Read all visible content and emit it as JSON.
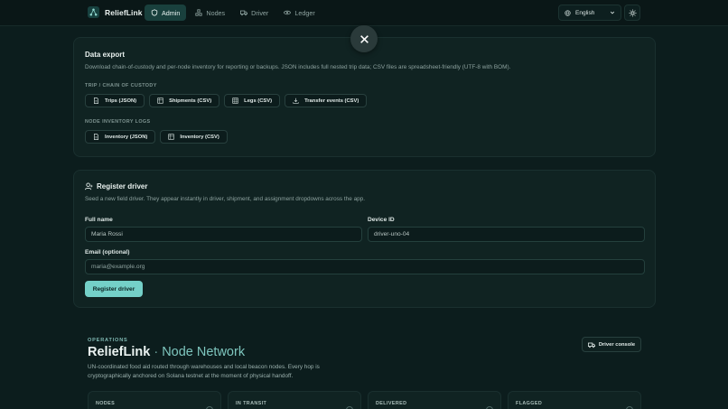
{
  "nav": {
    "brand": "ReliefLink",
    "items": [
      {
        "label": "Admin",
        "active": true
      },
      {
        "label": "Nodes",
        "active": false
      },
      {
        "label": "Driver",
        "active": false
      },
      {
        "label": "Ledger",
        "active": false
      }
    ],
    "language": "English"
  },
  "export": {
    "title": "Data export",
    "description": "Download chain-of-custody and per-node inventory for reporting or backups. JSON includes full nested trip data; CSV files are spreadsheet-friendly (UTF-8 with BOM).",
    "trip_section": "TRIP / CHAIN OF CUSTODY",
    "trip_buttons": [
      "Trips (JSON)",
      "Shipments (CSV)",
      "Legs (CSV)",
      "Transfer events (CSV)"
    ],
    "inventory_section": "NODE INVENTORY LOGS",
    "inventory_buttons": [
      "Inventory (JSON)",
      "Inventory (CSV)"
    ]
  },
  "register": {
    "title": "Register driver",
    "description": "Seed a new field driver. They appear instantly in driver, shipment, and assignment dropdowns across the app.",
    "full_name_label": "Full name",
    "full_name_value": "Maria Rossi",
    "device_id_label": "Device ID",
    "device_id_value": "driver-uno-04",
    "email_label": "Email (optional)",
    "email_placeholder": "maria@example.org",
    "submit_label": "Register driver"
  },
  "hero": {
    "eyebrow": "OPERATIONS",
    "title": "ReliefLink",
    "separator": "·",
    "subtitle": "Node Network",
    "description": "UN-coordinated food aid routed through warehouses and local beacon nodes. Every hop is cryptographically anchored on Solana testnet at the moment of physical handoff.",
    "console_button": "Driver console"
  },
  "stats": [
    {
      "label": "NODES"
    },
    {
      "label": "IN TRANSIT"
    },
    {
      "label": "DELIVERED"
    },
    {
      "label": "FLAGGED"
    }
  ],
  "colors": {
    "background": "#0c1d1d",
    "accent": "#74d0c8",
    "card": "#102322"
  },
  "icons": {
    "brand": "network-icon",
    "admin": "shield-icon",
    "nodes": "nodes-icon",
    "driver": "truck-icon",
    "ledger": "eye-icon",
    "language": "globe-icon",
    "theme": "sun-icon",
    "close": "close-icon"
  }
}
